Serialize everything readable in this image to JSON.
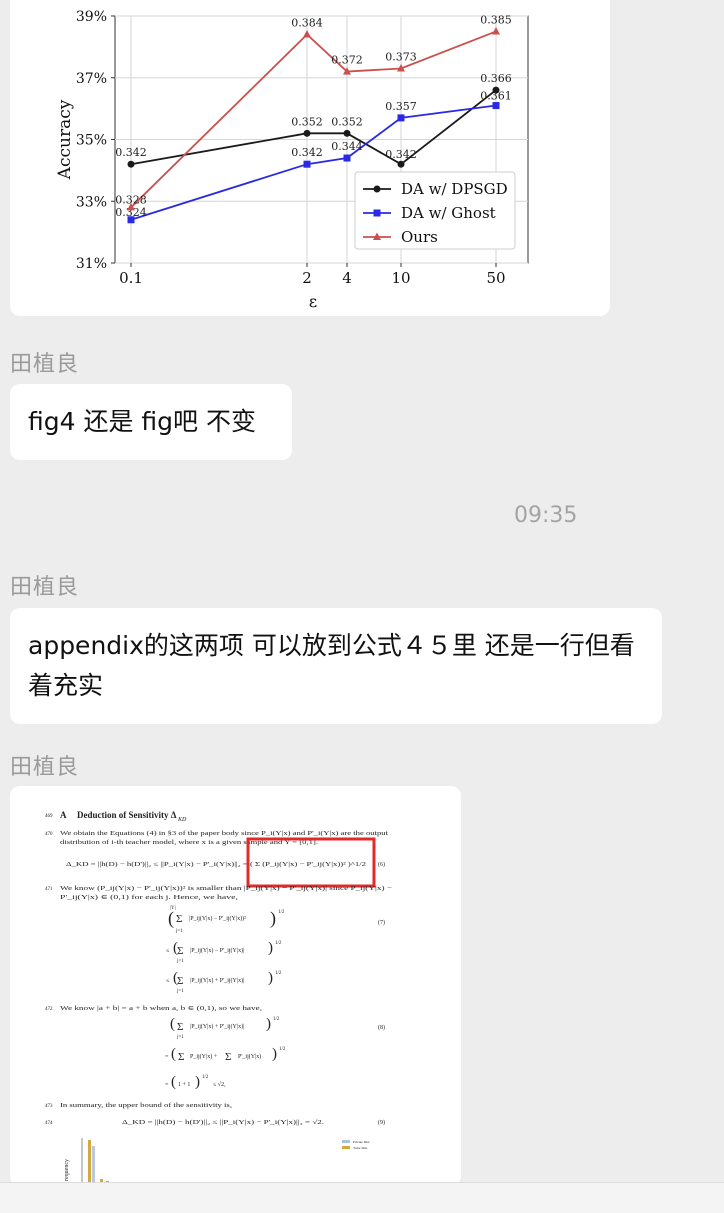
{
  "messages": [
    {
      "sender": "田植良",
      "text": "fig4 还是 fig吧 不变"
    },
    {
      "time": "09:35"
    },
    {
      "sender": "田植良",
      "text": "appendix的这两项 可以放到公式４５里 还是一行但看着充实"
    },
    {
      "sender": "田植良"
    }
  ],
  "chart_data": {
    "type": "line",
    "x_labels": [
      "0.1",
      "2",
      "4",
      "10",
      "50"
    ],
    "x": [
      0.1,
      2,
      4,
      10,
      50
    ],
    "xlabel": "ε",
    "ylabel": "Accuracy",
    "y_ticks": [
      "31%",
      "33%",
      "35%",
      "37%",
      "39%"
    ],
    "ylim": [
      0.31,
      0.39
    ],
    "grid": true,
    "legend_position": "lower-right",
    "series": [
      {
        "name": "DA w/ DPSGD",
        "values": [
          0.342,
          0.352,
          0.352,
          0.342,
          0.366
        ],
        "labels": [
          "0.342",
          "0.352",
          "0.352",
          "0.342",
          "0.366"
        ],
        "color": "#1a1a1a",
        "marker": "circle"
      },
      {
        "name": "DA w/ Ghost",
        "values": [
          0.324,
          0.342,
          0.344,
          0.357,
          0.361
        ],
        "labels": [
          "0.324",
          "0.342",
          "0.344",
          "0.357",
          "0.361"
        ],
        "color": "#2a2ae6",
        "marker": "square"
      },
      {
        "name": "Ours",
        "values": [
          0.328,
          0.384,
          0.372,
          0.373,
          0.385
        ],
        "labels": [
          "0.328",
          "0.384",
          "0.372",
          "0.373",
          "0.385"
        ],
        "color": "#c9504c",
        "marker": "triangle"
      }
    ]
  },
  "doc": {
    "heading_num": "A",
    "heading": "Deduction of Sensitivity Δ",
    "heading_sub": "KD",
    "line_nums": [
      "469",
      "470",
      "471",
      "472",
      "473",
      "474"
    ],
    "p1": "We obtain the Equations (4) in §3 of the paper body since P_i(Y|x) and P'_i(Y|x) are the output",
    "p1b": "distribution of i-th teacher model, where x is a given sample and Y = [0,1].",
    "eq6": "Δ_KD = ||h(D) − h(D')||₂ ≤ ||P_i(Y|x) − P'_i(Y|x)||₂ = ( Σ (P_ij(Y|x) − P'_ij(Y|x))² )^1/2",
    "p2": "We know (P_ij(Y|x) − P'_ij(Y|x))² is smaller than |P_ij(Y|x) − P'_ij(Y|x)| since P_ij(Y|x) −",
    "p2b": "P'_ij(Y|x) ∈ (0,1) for each j. Hence, we have,",
    "p3": "We know |a + b| = a + b when a, b ∈ (0,1), so we have,",
    "p4": "In summary, the upper bound of the sensitivity is,",
    "eq9": "Δ_KD = ||h(D) − h(D')||₂ ≤ ||P_i(Y|x) − P'_i(Y|x)||₂ = √2.",
    "eq_nums": [
      "(6)",
      "(7)",
      "(8)",
      "(9)"
    ],
    "legend": [
      "Private Dist",
      "Tutor Dist"
    ],
    "ylabel": "requency"
  }
}
